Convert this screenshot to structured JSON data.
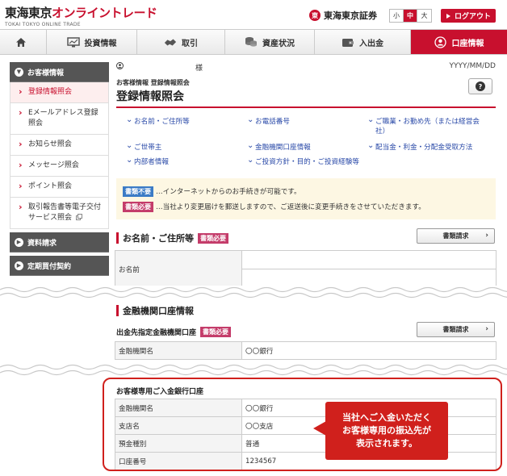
{
  "header": {
    "logo_dark": "東海東京",
    "logo_red": "オンライントレード",
    "logo_sub": "TOKAI TOKYO ONLINE TRADE",
    "brand_mark": "東",
    "brand_name": "東海東京証券",
    "font_sizes": [
      "小",
      "中",
      "大"
    ],
    "logout_label": "ログアウト"
  },
  "nav": {
    "items": [
      {
        "label": "",
        "icon": "home-icon"
      },
      {
        "label": "投資情報",
        "icon": "monitor-icon"
      },
      {
        "label": "取引",
        "icon": "handshake-icon"
      },
      {
        "label": "資産状況",
        "icon": "coins-icon"
      },
      {
        "label": "入出金",
        "icon": "wallet-icon"
      },
      {
        "label": "口座情報",
        "icon": "person-icon"
      }
    ]
  },
  "sidebar": {
    "customer_head": "お客様情報",
    "items": [
      "登録情報照会",
      "Eメールアドレス登録照会",
      "お知らせ照会",
      "メッセージ照会",
      "ポイント照会",
      "取引報告書等電子交付サービス照会"
    ],
    "head2": "資料請求",
    "head3": "定期買付契約"
  },
  "main": {
    "user_suffix": "様",
    "date": "YYYY/MM/DD",
    "breadcrumb": "お客様情報 登録情報照会",
    "title": "登録情報照会",
    "help": "?",
    "links": [
      "お名前・ご住所等",
      "お電話番号",
      "ご職業・お勤め先（または経営会社）",
      "ご世帯主",
      "金融機関口座情報",
      "配当金・利金・分配金受取方法",
      "内部者情報",
      "ご投資方針・目的・ご投資経験等"
    ],
    "notice": {
      "tag1": "書類不要",
      "text1": "…インターネットからのお手続きが可能です。",
      "tag2": "書類必要",
      "text2": "…当社より変更届けを郵送しますので、ご返送後に変更手続きをさせていただきます。"
    },
    "section_name": {
      "title": "お名前・ご住所等",
      "tag": "書類必要",
      "button": "書類請求",
      "row_label": "お名前"
    },
    "section_bank": {
      "title": "金融機関口座情報",
      "sub_title": "出金先指定金融機関口座",
      "tag": "書類必要",
      "button": "書類請求",
      "row_label": "金融機関名",
      "row_value": "〇〇銀行"
    },
    "deposit": {
      "title": "お客様専用ご入金銀行口座",
      "rows": [
        {
          "label": "金融機関名",
          "value": "〇〇銀行"
        },
        {
          "label": "支店名",
          "value": "〇〇支店"
        },
        {
          "label": "預金種別",
          "value": "普通"
        },
        {
          "label": "口座番号",
          "value": "1234567"
        }
      ]
    },
    "callout": [
      "当社へご入金いただく",
      "お客様専用の振込先が",
      "表示されます。"
    ]
  },
  "colors": {
    "accent": "#c8102e",
    "link": "#2a4aa8",
    "tag_blue": "#3b7bc6",
    "tag_pink": "#c43c6a",
    "notice_bg": "#fdf7e3"
  }
}
